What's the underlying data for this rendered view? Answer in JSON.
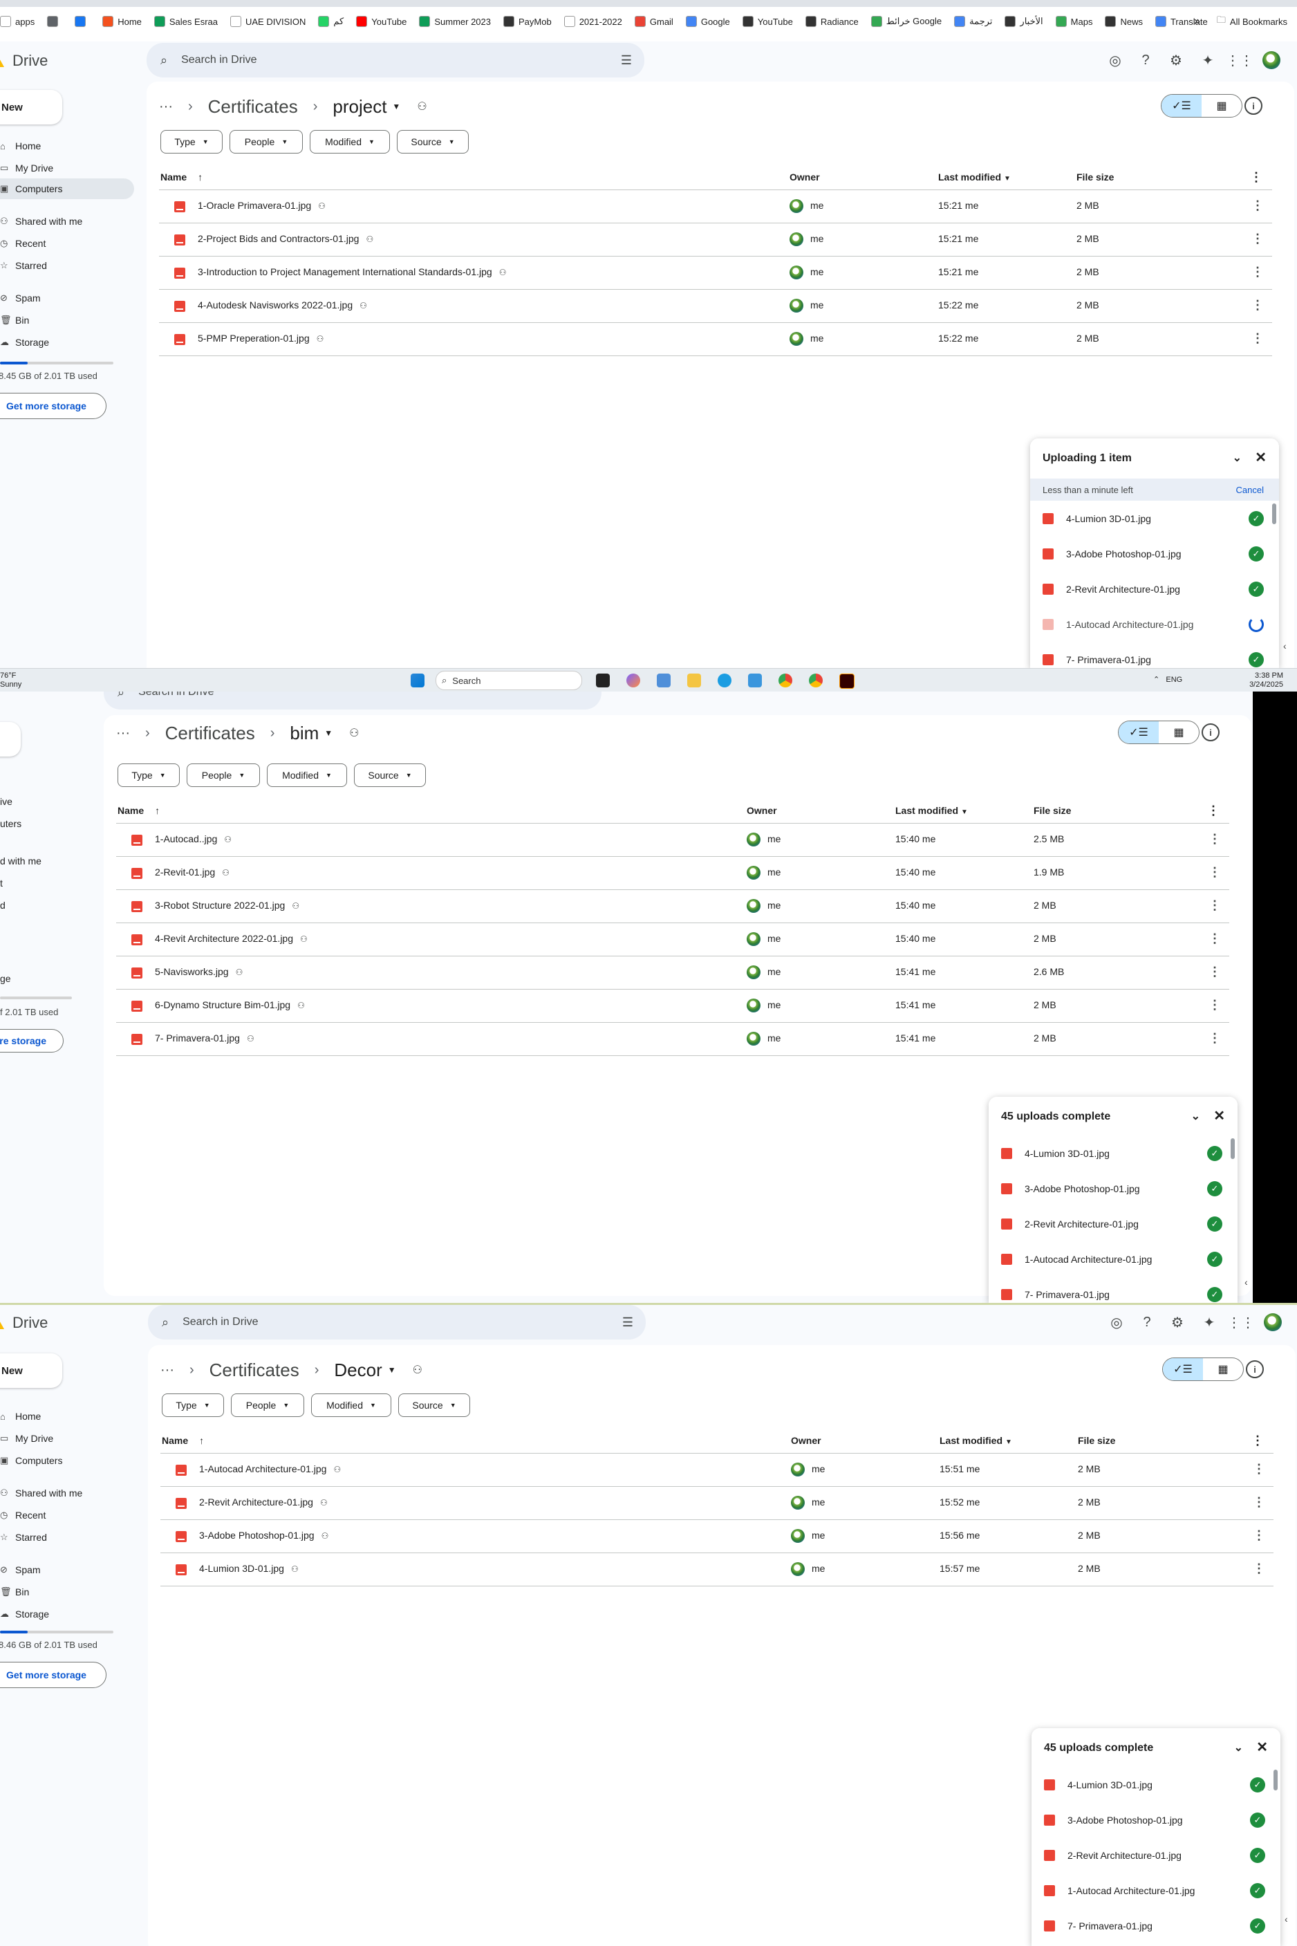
{
  "bookmarks": {
    "items": [
      {
        "label": "apps",
        "color": "#ffffff"
      },
      {
        "label": "",
        "color": "#5f6368"
      },
      {
        "label": "",
        "color": "#1877f2"
      },
      {
        "label": "Home",
        "color": "#f4511e"
      },
      {
        "label": "Sales Esraa",
        "color": "#0f9d58"
      },
      {
        "label": "UAE DIVISION",
        "color": "#ffffff"
      },
      {
        "label": "كم",
        "color": "#25d366"
      },
      {
        "label": "YouTube",
        "color": "#ff0000"
      },
      {
        "label": "Summer 2023",
        "color": "#0f9d58"
      },
      {
        "label": "PayMob",
        "color": "#333333"
      },
      {
        "label": "2021-2022",
        "color": "#ffffff"
      },
      {
        "label": "Gmail",
        "color": "#ea4335"
      },
      {
        "label": "Google",
        "color": "#4285f4"
      },
      {
        "label": "YouTube",
        "color": "#333333"
      },
      {
        "label": "Radiance",
        "color": "#333333"
      },
      {
        "label": "خرائط Google",
        "color": "#34a853"
      },
      {
        "label": "ترجمة",
        "color": "#4285f4"
      },
      {
        "label": "الأخبار",
        "color": "#333333"
      },
      {
        "label": "Maps",
        "color": "#34a853"
      },
      {
        "label": "News",
        "color": "#333333"
      },
      {
        "label": "Translate",
        "color": "#4285f4"
      }
    ],
    "more": "»",
    "all_bookmarks": "All Bookmarks"
  },
  "common": {
    "drive": "Drive",
    "new": "New",
    "search_placeholder": "Search in Drive",
    "nav": [
      "Home",
      "My Drive",
      "Computers",
      "Shared with me",
      "Recent",
      "Starred",
      "Spam",
      "Bin",
      "Storage"
    ],
    "get_more_storage": "Get more storage",
    "root_crumb": "Certificates",
    "chips": [
      "Type",
      "People",
      "Modified",
      "Source"
    ],
    "cols": {
      "name": "Name",
      "owner": "Owner",
      "modified": "Last modified",
      "size": "File size"
    },
    "owner": "me"
  },
  "panel1": {
    "folder": "project",
    "storage": "8.45 GB of 2.01 TB used",
    "rows": [
      {
        "name": "1-Oracle Primavera-01.jpg",
        "time": "15:21 me",
        "size": "2 MB"
      },
      {
        "name": "2-Project Bids and Contractors-01.jpg",
        "time": "15:21 me",
        "size": "2 MB"
      },
      {
        "name": "3-Introduction  to Project  Management International  Standards-01.jpg",
        "time": "15:21 me",
        "size": "2 MB"
      },
      {
        "name": "4-Autodesk Navisworks 2022-01.jpg",
        "time": "15:22 me",
        "size": "2 MB"
      },
      {
        "name": "5-PMP Preperation-01.jpg",
        "time": "15:22 me",
        "size": "2 MB"
      }
    ],
    "upload": {
      "title": "Uploading 1 item",
      "eta": "Less than a minute left",
      "cancel": "Cancel",
      "items": [
        {
          "name": "4-Lumion 3D-01.jpg",
          "state": "done"
        },
        {
          "name": "3-Adobe Photoshop-01.jpg",
          "state": "done"
        },
        {
          "name": "2-Revit Architecture-01.jpg",
          "state": "done"
        },
        {
          "name": "1-Autocad Architecture-01.jpg",
          "state": "progress"
        },
        {
          "name": "7- Primavera-01.jpg",
          "state": "done"
        }
      ]
    }
  },
  "taskbar": {
    "weather_temp": "76°F",
    "weather_text": "Sunny",
    "search": "Search",
    "lang": "ENG",
    "time": "3:38 PM",
    "date": "3/24/2025"
  },
  "panel2": {
    "search_partial": "Search in Drive",
    "folder": "bim",
    "nav_partial": [
      "ive",
      "uters",
      "d with me",
      "t",
      "d",
      "ge"
    ],
    "storage_partial": "f 2.01 TB used",
    "more_storage_partial": "re storage",
    "rows": [
      {
        "name": "1-Autocad..jpg",
        "time": "15:40 me",
        "size": "2.5 MB"
      },
      {
        "name": "2-Revit-01.jpg",
        "time": "15:40 me",
        "size": "1.9 MB"
      },
      {
        "name": "3-Robot Structure 2022-01.jpg",
        "time": "15:40 me",
        "size": "2 MB"
      },
      {
        "name": "4-Revit  Architecture 2022-01.jpg",
        "time": "15:40 me",
        "size": "2 MB"
      },
      {
        "name": "5-Navisworks.jpg",
        "time": "15:41 me",
        "size": "2.6 MB"
      },
      {
        "name": "6-Dynamo Structure Bim-01.jpg",
        "time": "15:41 me",
        "size": "2 MB"
      },
      {
        "name": "7- Primavera-01.jpg",
        "time": "15:41 me",
        "size": "2 MB"
      }
    ],
    "upload": {
      "title": "45 uploads complete",
      "items": [
        {
          "name": "4-Lumion 3D-01.jpg",
          "state": "done"
        },
        {
          "name": "3-Adobe Photoshop-01.jpg",
          "state": "done"
        },
        {
          "name": "2-Revit Architecture-01.jpg",
          "state": "done"
        },
        {
          "name": "1-Autocad Architecture-01.jpg",
          "state": "done"
        },
        {
          "name": "7- Primavera-01.jpg",
          "state": "done"
        }
      ]
    }
  },
  "panel3": {
    "folder": "Decor",
    "storage": "8.46 GB of 2.01 TB used",
    "rows": [
      {
        "name": "1-Autocad Architecture-01.jpg",
        "time": "15:51 me",
        "size": "2 MB"
      },
      {
        "name": "2-Revit Architecture-01.jpg",
        "time": "15:52 me",
        "size": "2 MB"
      },
      {
        "name": "3-Adobe Photoshop-01.jpg",
        "time": "15:56 me",
        "size": "2 MB"
      },
      {
        "name": "4-Lumion 3D-01.jpg",
        "time": "15:57 me",
        "size": "2 MB"
      }
    ],
    "upload": {
      "title": "45 uploads complete",
      "items": [
        {
          "name": "4-Lumion 3D-01.jpg",
          "state": "done"
        },
        {
          "name": "3-Adobe Photoshop-01.jpg",
          "state": "done"
        },
        {
          "name": "2-Revit Architecture-01.jpg",
          "state": "done"
        },
        {
          "name": "1-Autocad Architecture-01.jpg",
          "state": "done"
        },
        {
          "name": "7- Primavera-01.jpg",
          "state": "done"
        }
      ]
    }
  }
}
